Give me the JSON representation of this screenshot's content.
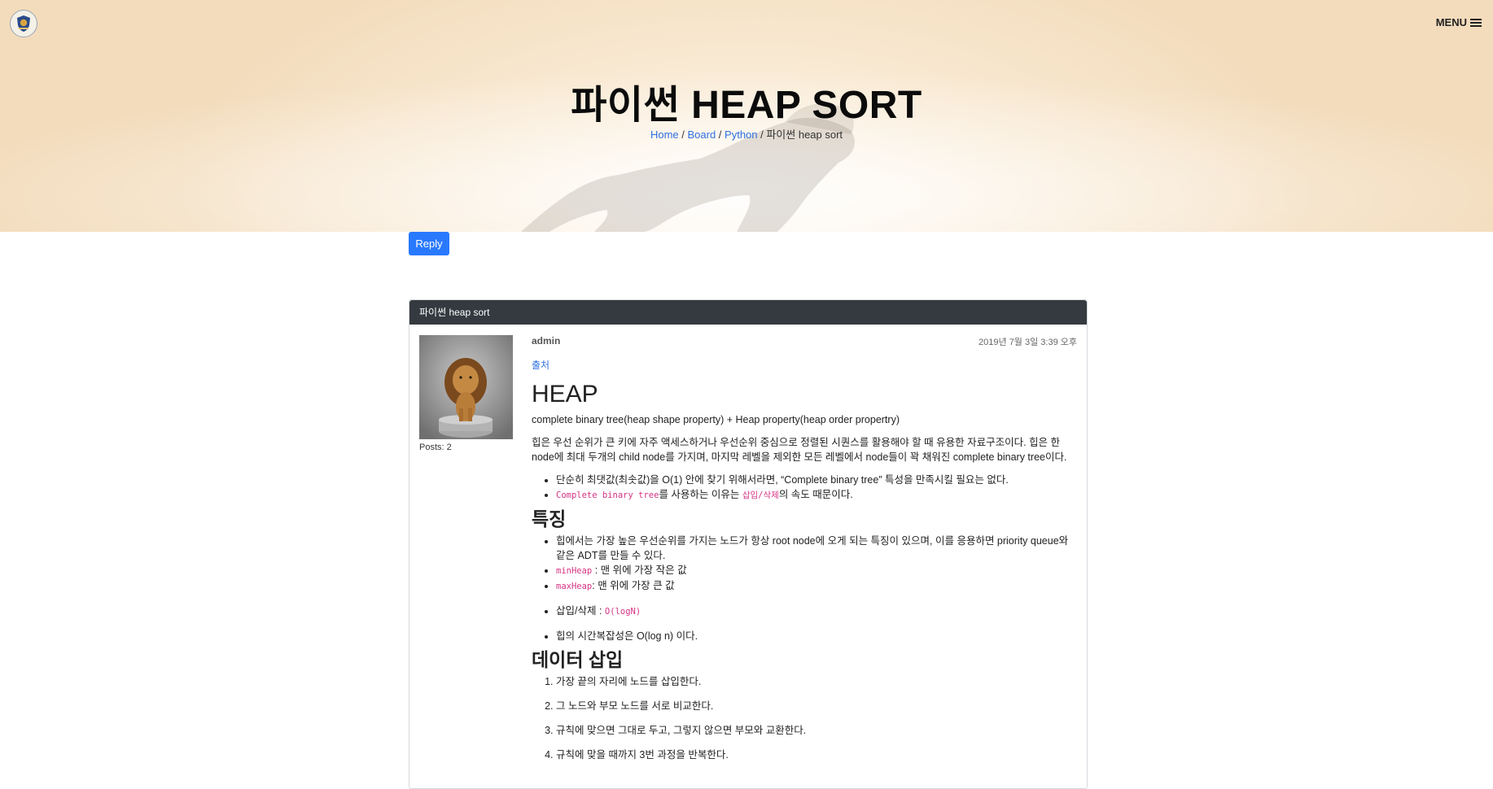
{
  "header": {
    "title": "파이썬 HEAP SORT",
    "menu_label": "MENU",
    "breadcrumb": {
      "home": "Home",
      "sep1": " / ",
      "board": "Board",
      "sep2": " / ",
      "python": "Python",
      "current": " / 파이썬 heap sort"
    }
  },
  "actions": {
    "reply_label": "Reply"
  },
  "post": {
    "card_title": "파이썬 heap sort",
    "author": "admin",
    "posts_count": "Posts: 2",
    "date": "2019년 7월 3일 3:39 오후",
    "source_label": "출처",
    "heading": "HEAP",
    "intro": "complete binary tree(heap shape property) + Heap property(heap order propertry)",
    "description": "힙은 우선 순위가 큰 키에 자주 액세스하거나 우선순위 중심으로 정렬된 시퀀스를 활용해야 할 때 유용한 자료구조이다. 힙은 한 node에 최대 두개의 child node를 가지며, 마지막 레벨을 제외한 모든 레벨에서 node들이 꽉 채워진 complete binary tree이다.",
    "bullets1": {
      "item1": "단순히 최댓값(최솟값)을 O(1) 안에 찾기 위해서라면, “Complete binary tree” 특성을 만족시킬 필요는 없다.",
      "item2_code1": "Complete binary tree",
      "item2_text1": "를 사용하는 이유는 ",
      "item2_code2": "삽입/삭제",
      "item2_text2": "의 속도 때문이다."
    },
    "features_heading": "특징",
    "features": {
      "item1": "힙에서는 가장 높은 우선순위를 가지는 노드가 항상 root node에 오게 되는 특징이 있으며, 이를 응용하면 priority queue와 같은 ADT를 만들 수 있다.",
      "min_code": "minHeap",
      "min_text": " : 맨 위에 가장 작은 값",
      "max_code": "maxHeap",
      "max_text": ": 맨 위에 가장 큰 값",
      "insert_text": "삽입/삭제 : ",
      "insert_code": "O(logN)",
      "complexity": "힙의 시간복잡성은 O(log n) 이다."
    },
    "insert_heading": "데이터 삽입",
    "insert_steps": [
      "가장 끝의 자리에 노드를 삽입한다.",
      "그 노드와 부모 노드를 서로 비교한다.",
      "규칙에 맞으면 그대로 두고, 그렇지 않으면 부모와 교환한다.",
      "규칙에 맞을 때까지 3번 과정을 반복한다."
    ]
  }
}
